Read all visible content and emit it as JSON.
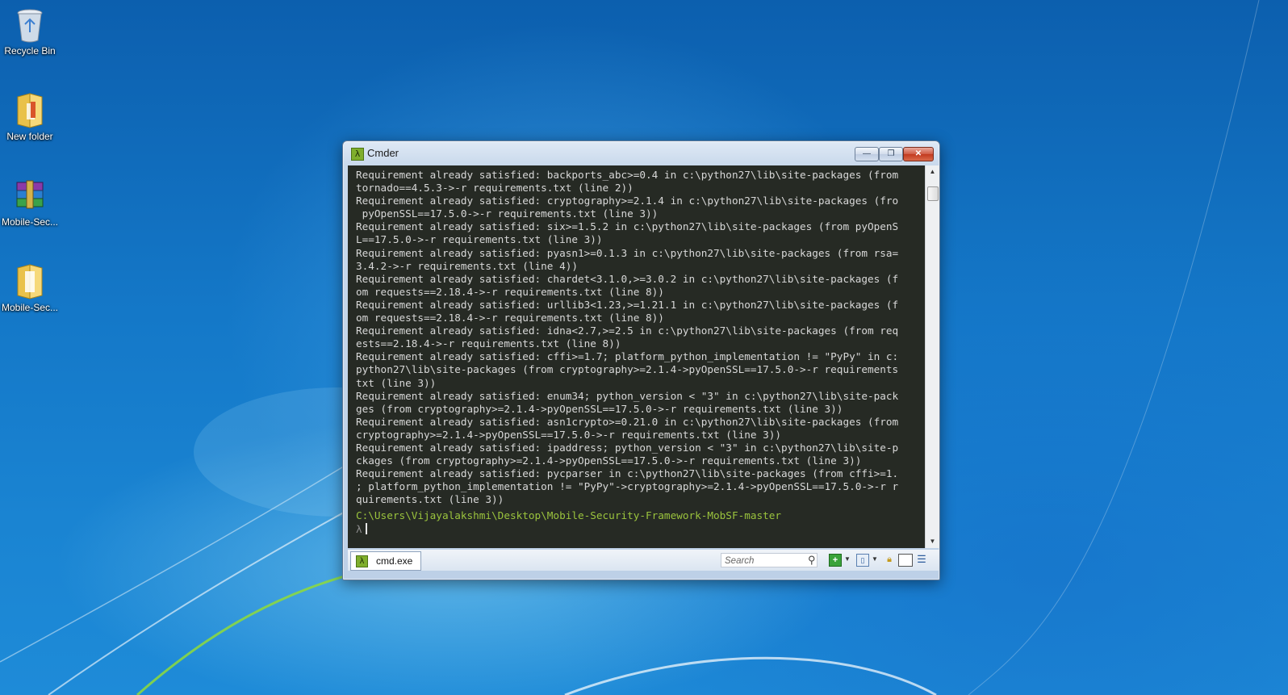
{
  "desktop": {
    "icons": [
      {
        "label": "Recycle Bin",
        "icon": "recycle-bin-icon"
      },
      {
        "label": "New folder",
        "icon": "folder-icon"
      },
      {
        "label": "Mobile-Sec...",
        "icon": "winrar-archive-icon"
      },
      {
        "label": "Mobile-Sec...",
        "icon": "folder-icon"
      }
    ]
  },
  "window": {
    "title": "Cmder",
    "logo_glyph": "λ",
    "minimize_glyph": "—",
    "maximize_glyph": "❐",
    "close_glyph": "✕"
  },
  "terminal": {
    "lines": [
      "Requirement already satisfied: backports_abc>=0.4 in c:\\python27\\lib\\site-packages (from",
      "tornado==4.5.3->-r requirements.txt (line 2))",
      "Requirement already satisfied: cryptography>=2.1.4 in c:\\python27\\lib\\site-packages (fro",
      " pyOpenSSL==17.5.0->-r requirements.txt (line 3))",
      "Requirement already satisfied: six>=1.5.2 in c:\\python27\\lib\\site-packages (from pyOpenS",
      "L==17.5.0->-r requirements.txt (line 3))",
      "Requirement already satisfied: pyasn1>=0.1.3 in c:\\python27\\lib\\site-packages (from rsa=",
      "3.4.2->-r requirements.txt (line 4))",
      "Requirement already satisfied: chardet<3.1.0,>=3.0.2 in c:\\python27\\lib\\site-packages (f",
      "om requests==2.18.4->-r requirements.txt (line 8))",
      "Requirement already satisfied: urllib3<1.23,>=1.21.1 in c:\\python27\\lib\\site-packages (f",
      "om requests==2.18.4->-r requirements.txt (line 8))",
      "Requirement already satisfied: idna<2.7,>=2.5 in c:\\python27\\lib\\site-packages (from req",
      "ests==2.18.4->-r requirements.txt (line 8))",
      "Requirement already satisfied: cffi>=1.7; platform_python_implementation != \"PyPy\" in c:",
      "python27\\lib\\site-packages (from cryptography>=2.1.4->pyOpenSSL==17.5.0->-r requirements",
      "txt (line 3))",
      "Requirement already satisfied: enum34; python_version < \"3\" in c:\\python27\\lib\\site-pack",
      "ges (from cryptography>=2.1.4->pyOpenSSL==17.5.0->-r requirements.txt (line 3))",
      "Requirement already satisfied: asn1crypto>=0.21.0 in c:\\python27\\lib\\site-packages (from",
      "cryptography>=2.1.4->pyOpenSSL==17.5.0->-r requirements.txt (line 3))",
      "Requirement already satisfied: ipaddress; python_version < \"3\" in c:\\python27\\lib\\site-p",
      "ckages (from cryptography>=2.1.4->pyOpenSSL==17.5.0->-r requirements.txt (line 3))",
      "Requirement already satisfied: pycparser in c:\\python27\\lib\\site-packages (from cffi>=1.",
      "; platform_python_implementation != \"PyPy\"->cryptography>=2.1.4->pyOpenSSL==17.5.0->-r r",
      "quirements.txt (line 3))"
    ],
    "cwd": "C:\\Users\\Vijayalakshmi\\Desktop\\Mobile-Security-Framework-MobSF-master",
    "prompt": "λ"
  },
  "statusbar": {
    "tab_label": "cmd.exe",
    "search_placeholder": "Search",
    "icons": [
      "search-icon",
      "new-console-icon",
      "dropdown-icon",
      "layout-icon",
      "dropdown-icon",
      "lock-icon",
      "split-view-icon",
      "menu-icon"
    ]
  },
  "colors": {
    "terminal_bg": "#262a24",
    "terminal_fg": "#d8d8d8",
    "path_color": "#9bc43d",
    "accent": "#7fae2c"
  }
}
